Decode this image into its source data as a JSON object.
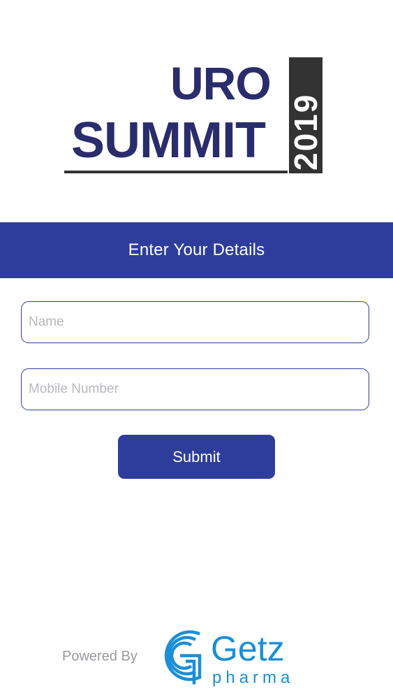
{
  "logo": {
    "line1": "URO",
    "line2": "SUMMIT",
    "year": "2019"
  },
  "header": {
    "title": "Enter Your Details"
  },
  "form": {
    "name_placeholder": "Name",
    "name_value": "",
    "mobile_placeholder": "Mobile Number",
    "mobile_value": "",
    "submit_label": "Submit"
  },
  "footer": {
    "powered_by": "Powered By",
    "brand_name": "Getz",
    "brand_sub": "pharma"
  },
  "colors": {
    "primary": "#2e3d9c",
    "logo_navy": "#2a2c6b",
    "getz_blue": "#1a8fd6"
  }
}
